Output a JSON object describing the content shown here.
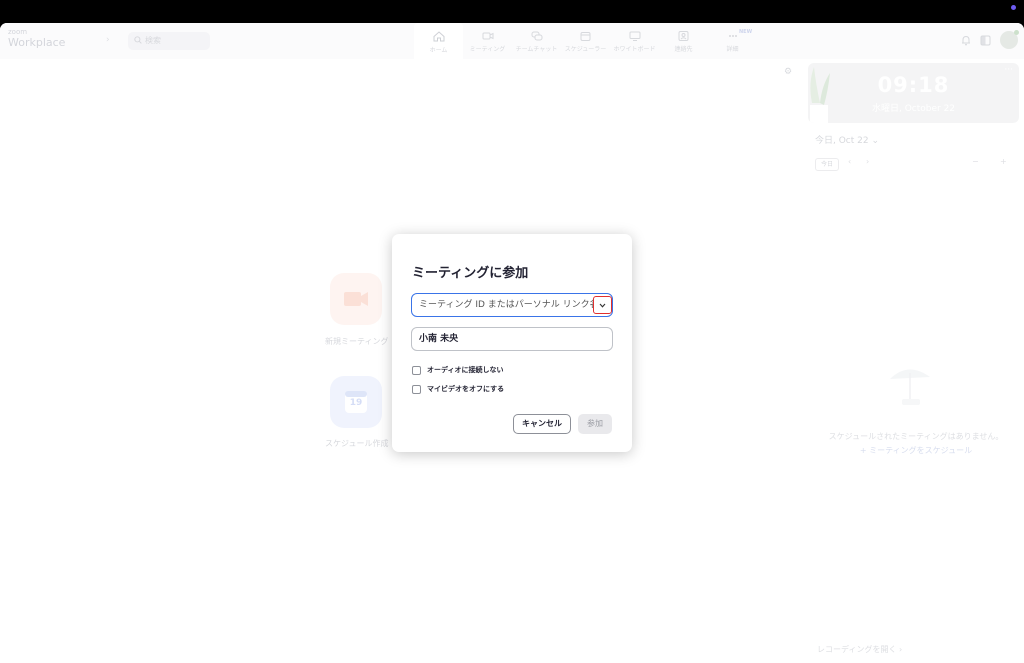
{
  "header": {
    "logo_line1": "zoom",
    "logo_line2": "Workplace",
    "search_placeholder": "検索",
    "tabs": [
      {
        "label": "ホーム",
        "icon": "home-icon"
      },
      {
        "label": "ミーティング",
        "icon": "video-icon"
      },
      {
        "label": "チームチャット",
        "icon": "chat-icon"
      },
      {
        "label": "スケジューラー",
        "icon": "calendar-icon"
      },
      {
        "label": "ホワイトボード",
        "icon": "whiteboard-icon"
      },
      {
        "label": "連絡先",
        "icon": "contacts-icon"
      },
      {
        "label": "詳細",
        "icon": "more-icon",
        "badge": "NEW"
      }
    ]
  },
  "home": {
    "new_meeting_label": "新規ミーティング",
    "schedule_label": "スケジュール作成",
    "calendar_day": "19"
  },
  "right_panel": {
    "clock_time": "09:18",
    "clock_date": "水曜日, October 22",
    "today_line": "今日, Oct 22",
    "today_button": "今日",
    "empty_message": "スケジュールされたミーティングはありません。",
    "schedule_link": "ミーティングをスケジュール",
    "recordings_link": "レコーディングを開く"
  },
  "dialog": {
    "title": "ミーティングに参加",
    "id_placeholder": "ミーティング ID またはパーソナル リンク名",
    "name_value": "小南 未央",
    "checkbox_audio": "オーディオに接続しない",
    "checkbox_video": "マイビデオをオフにする",
    "cancel_label": "キャンセル",
    "join_label": "参加"
  },
  "colors": {
    "accent_blue": "#3a74e8",
    "highlight_red": "#e0302f"
  }
}
